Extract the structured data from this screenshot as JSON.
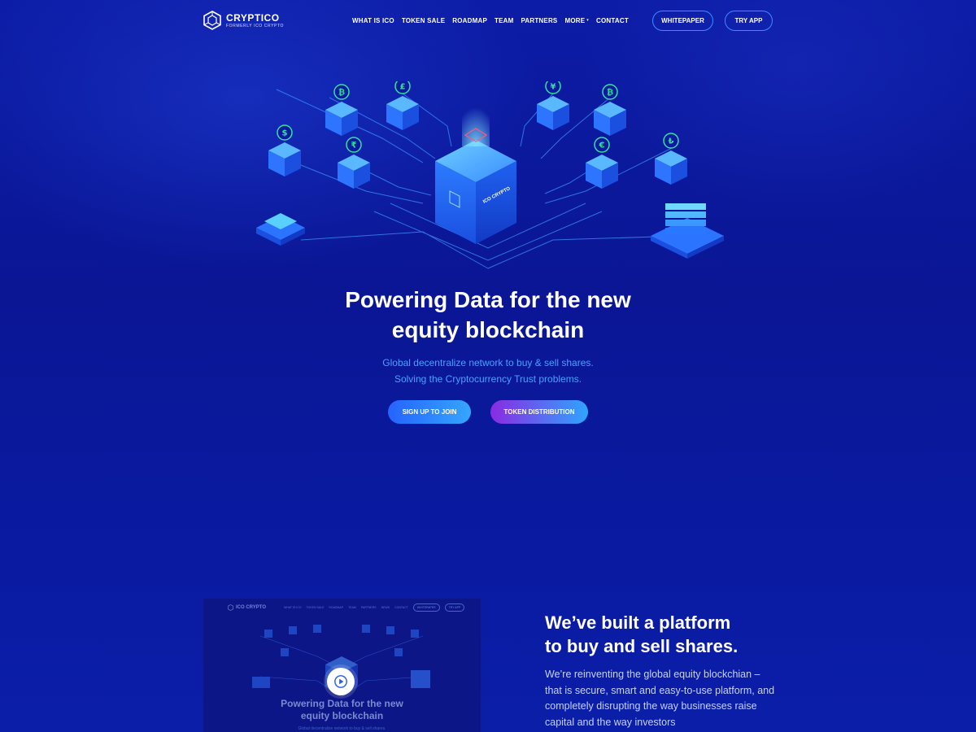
{
  "brand": {
    "name": "CRYPTICO",
    "subtitle": "FORMERLY ICO CRYPTO"
  },
  "nav": {
    "items": [
      "WHAT IS ICO",
      "TOKEN SALE",
      "ROADMAP",
      "TEAM",
      "PARTNERS",
      "MORE",
      "CONTACT"
    ],
    "more_caret": "▾"
  },
  "header_buttons": {
    "whitepaper": "WHITEPAPER",
    "try_app": "TRY APP"
  },
  "hero": {
    "title_line1": "Powering Data for the new",
    "title_line2": "equity blockchain",
    "subtitle_line1": "Global decentralize network to buy & sell shares.",
    "subtitle_line2": "Solving the Cryptocurrency Trust problems.",
    "signup_label": "SIGN UP TO JOIN",
    "token_label": "TOKEN DISTRIBUTION",
    "cube_label": "ICO CRYPTO",
    "currency_symbols": [
      "$",
      "₿",
      "£",
      "₹",
      "₿",
      "¥",
      "₿",
      "€",
      "₺"
    ],
    "flow_symbols": [
      "$",
      "₹",
      "₿",
      "£",
      "¥",
      "₿",
      "€",
      "₺"
    ]
  },
  "preview": {
    "logo": "ICO CRYPTO",
    "nav": [
      "WHAT IS ICO",
      "TOKEN SALE",
      "ROADMAP",
      "TEAM",
      "PARTNERS",
      "NEWS",
      "CONTACT"
    ],
    "whitepaper": "WHITEPAPER",
    "try_app": "TRY APP",
    "title_line1": "Powering Data for the new",
    "title_line2": "equity blockchain",
    "subtitle": "Global decentralize network to buy & sell shares."
  },
  "about": {
    "title_line1": "We’ve built a platform",
    "title_line2": "to buy and sell shares.",
    "text": "We’re reinventing the global equity blockchian – that is secure, smart and easy-to-use platform, and completely disrupting the way businesses raise capital and the way investors"
  },
  "colors": {
    "background": "#0b1a9e",
    "accent_blue": "#3d8cff",
    "subtitle_blue": "#4aa0ff",
    "cube_blue": "#2f7bff",
    "coin_green": "#36e0a0"
  }
}
